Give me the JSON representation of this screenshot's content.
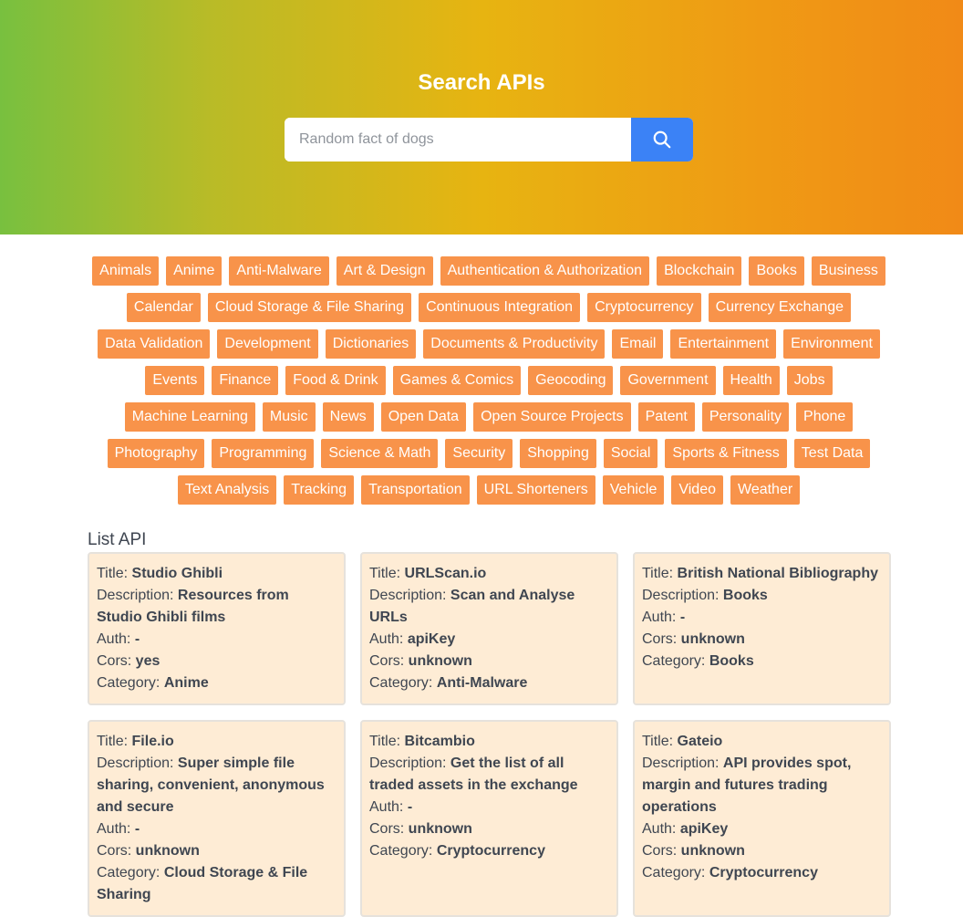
{
  "hero": {
    "title": "Search APIs",
    "search_placeholder": "Random fact of dogs",
    "search_icon": "search-icon"
  },
  "categories": [
    "Animals",
    "Anime",
    "Anti-Malware",
    "Art & Design",
    "Authentication & Authorization",
    "Blockchain",
    "Books",
    "Business",
    "Calendar",
    "Cloud Storage & File Sharing",
    "Continuous Integration",
    "Cryptocurrency",
    "Currency Exchange",
    "Data Validation",
    "Development",
    "Dictionaries",
    "Documents & Productivity",
    "Email",
    "Entertainment",
    "Environment",
    "Events",
    "Finance",
    "Food & Drink",
    "Games & Comics",
    "Geocoding",
    "Government",
    "Health",
    "Jobs",
    "Machine Learning",
    "Music",
    "News",
    "Open Data",
    "Open Source Projects",
    "Patent",
    "Personality",
    "Phone",
    "Photography",
    "Programming",
    "Science & Math",
    "Security",
    "Shopping",
    "Social",
    "Sports & Fitness",
    "Test Data",
    "Text Analysis",
    "Tracking",
    "Transportation",
    "URL Shorteners",
    "Vehicle",
    "Video",
    "Weather"
  ],
  "list": {
    "title": "List API",
    "labels": {
      "title": "Title: ",
      "description": "Description: ",
      "auth": "Auth: ",
      "cors": "Cors: ",
      "category": "Category: "
    },
    "items": [
      {
        "title": "Studio Ghibli",
        "description": "Resources from Studio Ghibli films",
        "auth": "-",
        "cors": "yes",
        "category": "Anime"
      },
      {
        "title": "URLScan.io",
        "description": "Scan and Analyse URLs",
        "auth": "apiKey",
        "cors": "unknown",
        "category": "Anti-Malware"
      },
      {
        "title": "British National Bibliography",
        "description": "Books",
        "auth": "-",
        "cors": "unknown",
        "category": "Books"
      },
      {
        "title": "File.io",
        "description": "Super simple file sharing, convenient, anonymous and secure",
        "auth": "-",
        "cors": "unknown",
        "category": "Cloud Storage & File Sharing"
      },
      {
        "title": "Bitcambio",
        "description": "Get the list of all traded assets in the exchange",
        "auth": "-",
        "cors": "unknown",
        "category": "Cryptocurrency"
      },
      {
        "title": "Gateio",
        "description": "API provides spot, margin and futures trading operations",
        "auth": "apiKey",
        "cors": "unknown",
        "category": "Cryptocurrency"
      }
    ]
  },
  "colors": {
    "tag_bg": "#f8934a",
    "card_bg": "#feecd5",
    "search_button": "#3b82f6"
  }
}
